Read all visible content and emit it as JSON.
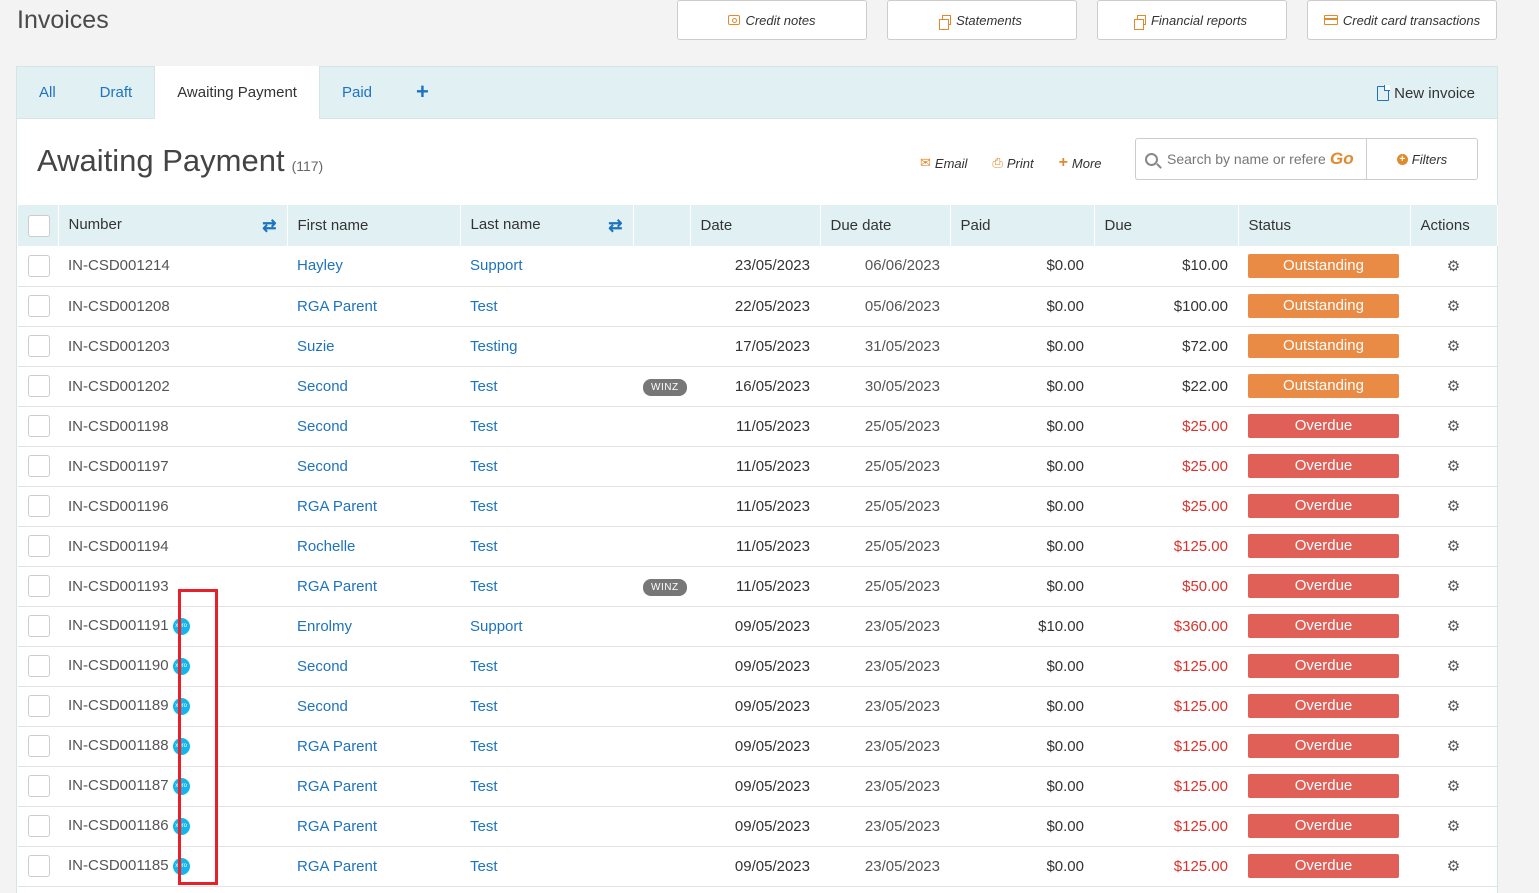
{
  "page_title": "Invoices",
  "top_buttons": [
    {
      "label": "Credit notes",
      "icon": "note-icon"
    },
    {
      "label": "Statements",
      "icon": "copy-icon"
    },
    {
      "label": "Financial reports",
      "icon": "copy-icon"
    },
    {
      "label": "Credit card transactions",
      "icon": "credit-card-icon"
    }
  ],
  "tabs": [
    {
      "label": "All",
      "active": false
    },
    {
      "label": "Draft",
      "active": false
    },
    {
      "label": "Awaiting Payment",
      "active": true
    },
    {
      "label": "Paid",
      "active": false
    }
  ],
  "tab_add_label": "+",
  "new_invoice_label": "New invoice",
  "section": {
    "title": "Awaiting Payment",
    "count": "(117)"
  },
  "toolbar": {
    "email": "Email",
    "print": "Print",
    "more": "More"
  },
  "search": {
    "placeholder": "Search by name or reference",
    "go_label": "Go"
  },
  "filters_label": "Filters",
  "columns": [
    "Number",
    "First name",
    "Last name",
    "",
    "Date",
    "Due date",
    "Paid",
    "Due",
    "Status",
    "Actions"
  ],
  "rows": [
    {
      "number": "IN-CSD001214",
      "xero": false,
      "first": "Hayley",
      "last": "Support",
      "tag": "",
      "date": "23/05/2023",
      "due_date": "06/06/2023",
      "paid": "$0.00",
      "due": "$10.00",
      "status": "Outstanding"
    },
    {
      "number": "IN-CSD001208",
      "xero": false,
      "first": "RGA Parent",
      "last": "Test",
      "tag": "",
      "date": "22/05/2023",
      "due_date": "05/06/2023",
      "paid": "$0.00",
      "due": "$100.00",
      "status": "Outstanding"
    },
    {
      "number": "IN-CSD001203",
      "xero": false,
      "first": "Suzie",
      "last": "Testing",
      "tag": "",
      "date": "17/05/2023",
      "due_date": "31/05/2023",
      "paid": "$0.00",
      "due": "$72.00",
      "status": "Outstanding"
    },
    {
      "number": "IN-CSD001202",
      "xero": false,
      "first": "Second",
      "last": "Test",
      "tag": "WINZ",
      "date": "16/05/2023",
      "due_date": "30/05/2023",
      "paid": "$0.00",
      "due": "$22.00",
      "status": "Outstanding"
    },
    {
      "number": "IN-CSD001198",
      "xero": false,
      "first": "Second",
      "last": "Test",
      "tag": "",
      "date": "11/05/2023",
      "due_date": "25/05/2023",
      "paid": "$0.00",
      "due": "$25.00",
      "status": "Overdue"
    },
    {
      "number": "IN-CSD001197",
      "xero": false,
      "first": "Second",
      "last": "Test",
      "tag": "",
      "date": "11/05/2023",
      "due_date": "25/05/2023",
      "paid": "$0.00",
      "due": "$25.00",
      "status": "Overdue"
    },
    {
      "number": "IN-CSD001196",
      "xero": false,
      "first": "RGA Parent",
      "last": "Test",
      "tag": "",
      "date": "11/05/2023",
      "due_date": "25/05/2023",
      "paid": "$0.00",
      "due": "$25.00",
      "status": "Overdue"
    },
    {
      "number": "IN-CSD001194",
      "xero": false,
      "first": "Rochelle",
      "last": "Test",
      "tag": "",
      "date": "11/05/2023",
      "due_date": "25/05/2023",
      "paid": "$0.00",
      "due": "$125.00",
      "status": "Overdue"
    },
    {
      "number": "IN-CSD001193",
      "xero": false,
      "first": "RGA Parent",
      "last": "Test",
      "tag": "WINZ",
      "date": "11/05/2023",
      "due_date": "25/05/2023",
      "paid": "$0.00",
      "due": "$50.00",
      "status": "Overdue"
    },
    {
      "number": "IN-CSD001191",
      "xero": true,
      "first": "Enrolmy",
      "last": "Support",
      "tag": "",
      "date": "09/05/2023",
      "due_date": "23/05/2023",
      "paid": "$10.00",
      "due": "$360.00",
      "status": "Overdue"
    },
    {
      "number": "IN-CSD001190",
      "xero": true,
      "first": "Second",
      "last": "Test",
      "tag": "",
      "date": "09/05/2023",
      "due_date": "23/05/2023",
      "paid": "$0.00",
      "due": "$125.00",
      "status": "Overdue"
    },
    {
      "number": "IN-CSD001189",
      "xero": true,
      "first": "Second",
      "last": "Test",
      "tag": "",
      "date": "09/05/2023",
      "due_date": "23/05/2023",
      "paid": "$0.00",
      "due": "$125.00",
      "status": "Overdue"
    },
    {
      "number": "IN-CSD001188",
      "xero": true,
      "first": "RGA Parent",
      "last": "Test",
      "tag": "",
      "date": "09/05/2023",
      "due_date": "23/05/2023",
      "paid": "$0.00",
      "due": "$125.00",
      "status": "Overdue"
    },
    {
      "number": "IN-CSD001187",
      "xero": true,
      "first": "RGA Parent",
      "last": "Test",
      "tag": "",
      "date": "09/05/2023",
      "due_date": "23/05/2023",
      "paid": "$0.00",
      "due": "$125.00",
      "status": "Overdue"
    },
    {
      "number": "IN-CSD001186",
      "xero": true,
      "first": "RGA Parent",
      "last": "Test",
      "tag": "",
      "date": "09/05/2023",
      "due_date": "23/05/2023",
      "paid": "$0.00",
      "due": "$125.00",
      "status": "Overdue"
    },
    {
      "number": "IN-CSD001185",
      "xero": true,
      "first": "RGA Parent",
      "last": "Test",
      "tag": "",
      "date": "09/05/2023",
      "due_date": "23/05/2023",
      "paid": "$0.00",
      "due": "$125.00",
      "status": "Overdue"
    }
  ],
  "xero_label": "xero",
  "overdue_color": "#d9322c",
  "colors": {
    "accent": "#1e73be",
    "orange": "#e08a2c",
    "outstanding": "#e98b45",
    "overdue": "#e06058",
    "highlight": "#e8202a"
  }
}
